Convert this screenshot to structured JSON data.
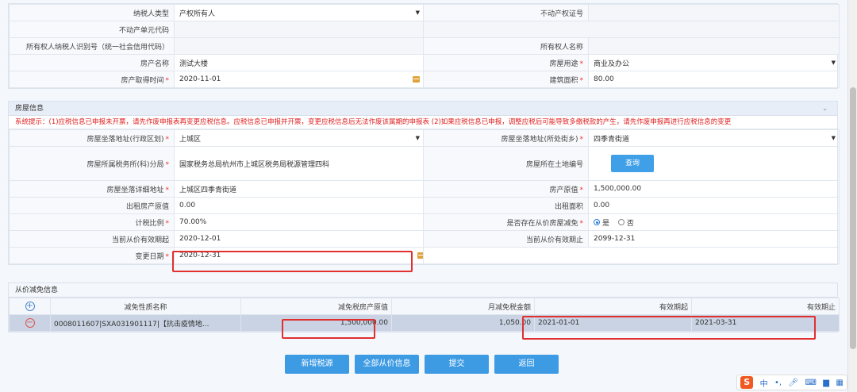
{
  "top_form": {
    "rows": [
      {
        "l1": "纳税人类型",
        "v1": "产权所有人",
        "v1_select": true,
        "l2": "不动产权证号",
        "v2": ""
      },
      {
        "l1": "不动产单元代码",
        "v1": "",
        "l2": "",
        "v2": ""
      },
      {
        "l1": "所有权人纳税人识别号（统一社会信用代码）",
        "v1": "",
        "l2": "所有权人名称",
        "v2": ""
      },
      {
        "l1": "房产名称",
        "v1": "测试大楼",
        "l2": "房屋用途",
        "l2_req": "*",
        "v2": "商业及办公",
        "v2_select": true
      },
      {
        "l1": "房产取得时间",
        "l1_req": "*",
        "v1": "2020-11-01",
        "v1_date": true,
        "l2": "建筑面积",
        "l2_req": "*",
        "v2": "80.00"
      }
    ]
  },
  "house_section": {
    "title": "房屋信息",
    "notice": "系统提示：(1)应税信息已申报未开票，请先作废申报表再变更应税信息。应税信息已申报并开票，变更应税信息后无法作废该属期的申报表 (2)如果应税信息已申报，调整应税后可能导致多缴税款的产生，请先作废申报再进行应税信息的变更",
    "district_label": "房屋坐落地址(行政区划)",
    "district_value": "上城区",
    "street_label": "房屋坐落地址(所处街乡)",
    "street_value": "四季青街道",
    "tax_office_label": "房屋所属税务所(科)分局",
    "tax_office_value": "国家税务总局杭州市上城区税务局税源管理四科",
    "land_no_label": "房屋所在土地编号",
    "query_button": "查询",
    "address_label": "房屋坐落详细地址",
    "address_value": "上城区四季青街道",
    "original_value_label": "房产原值",
    "original_value": "1,500,000.00",
    "rent_original_label": "出租房产原值",
    "rent_original_value": "0.00",
    "rent_area_label": "出租面积",
    "rent_area_value": "0.00",
    "tax_ratio_label": "计税比例",
    "tax_ratio_value": "70.00%",
    "reduction_label": "是否存在从价房屋减免",
    "reduction_yes": "是",
    "reduction_no": "否",
    "valid_start_label": "当前从价有效期起",
    "valid_start_value": "2020-12-01",
    "valid_end_label": "当前从价有效期止",
    "valid_end_value": "2099-12-31",
    "change_date_label": "变更日期",
    "change_date_value": "2020-12-31",
    "req": "*"
  },
  "relief_section": {
    "title": "从价减免信息",
    "headers": [
      "减免性质名称",
      "减免税房产原值",
      "月减免税金额",
      "有效期起",
      "有效期止"
    ],
    "row": {
      "name": "0008011607|SXA031901117|【抗击疫情地...",
      "original": "1,500,000.00",
      "monthly": "1,050.00",
      "start": "2021-01-01",
      "end": "2021-03-31"
    }
  },
  "buttons": {
    "add_source": "新增税源",
    "all_info": "全部从价信息",
    "submit": "提交",
    "back": "返回"
  },
  "ime": {
    "logo": "S",
    "lang": "中",
    "punct": "•,"
  }
}
